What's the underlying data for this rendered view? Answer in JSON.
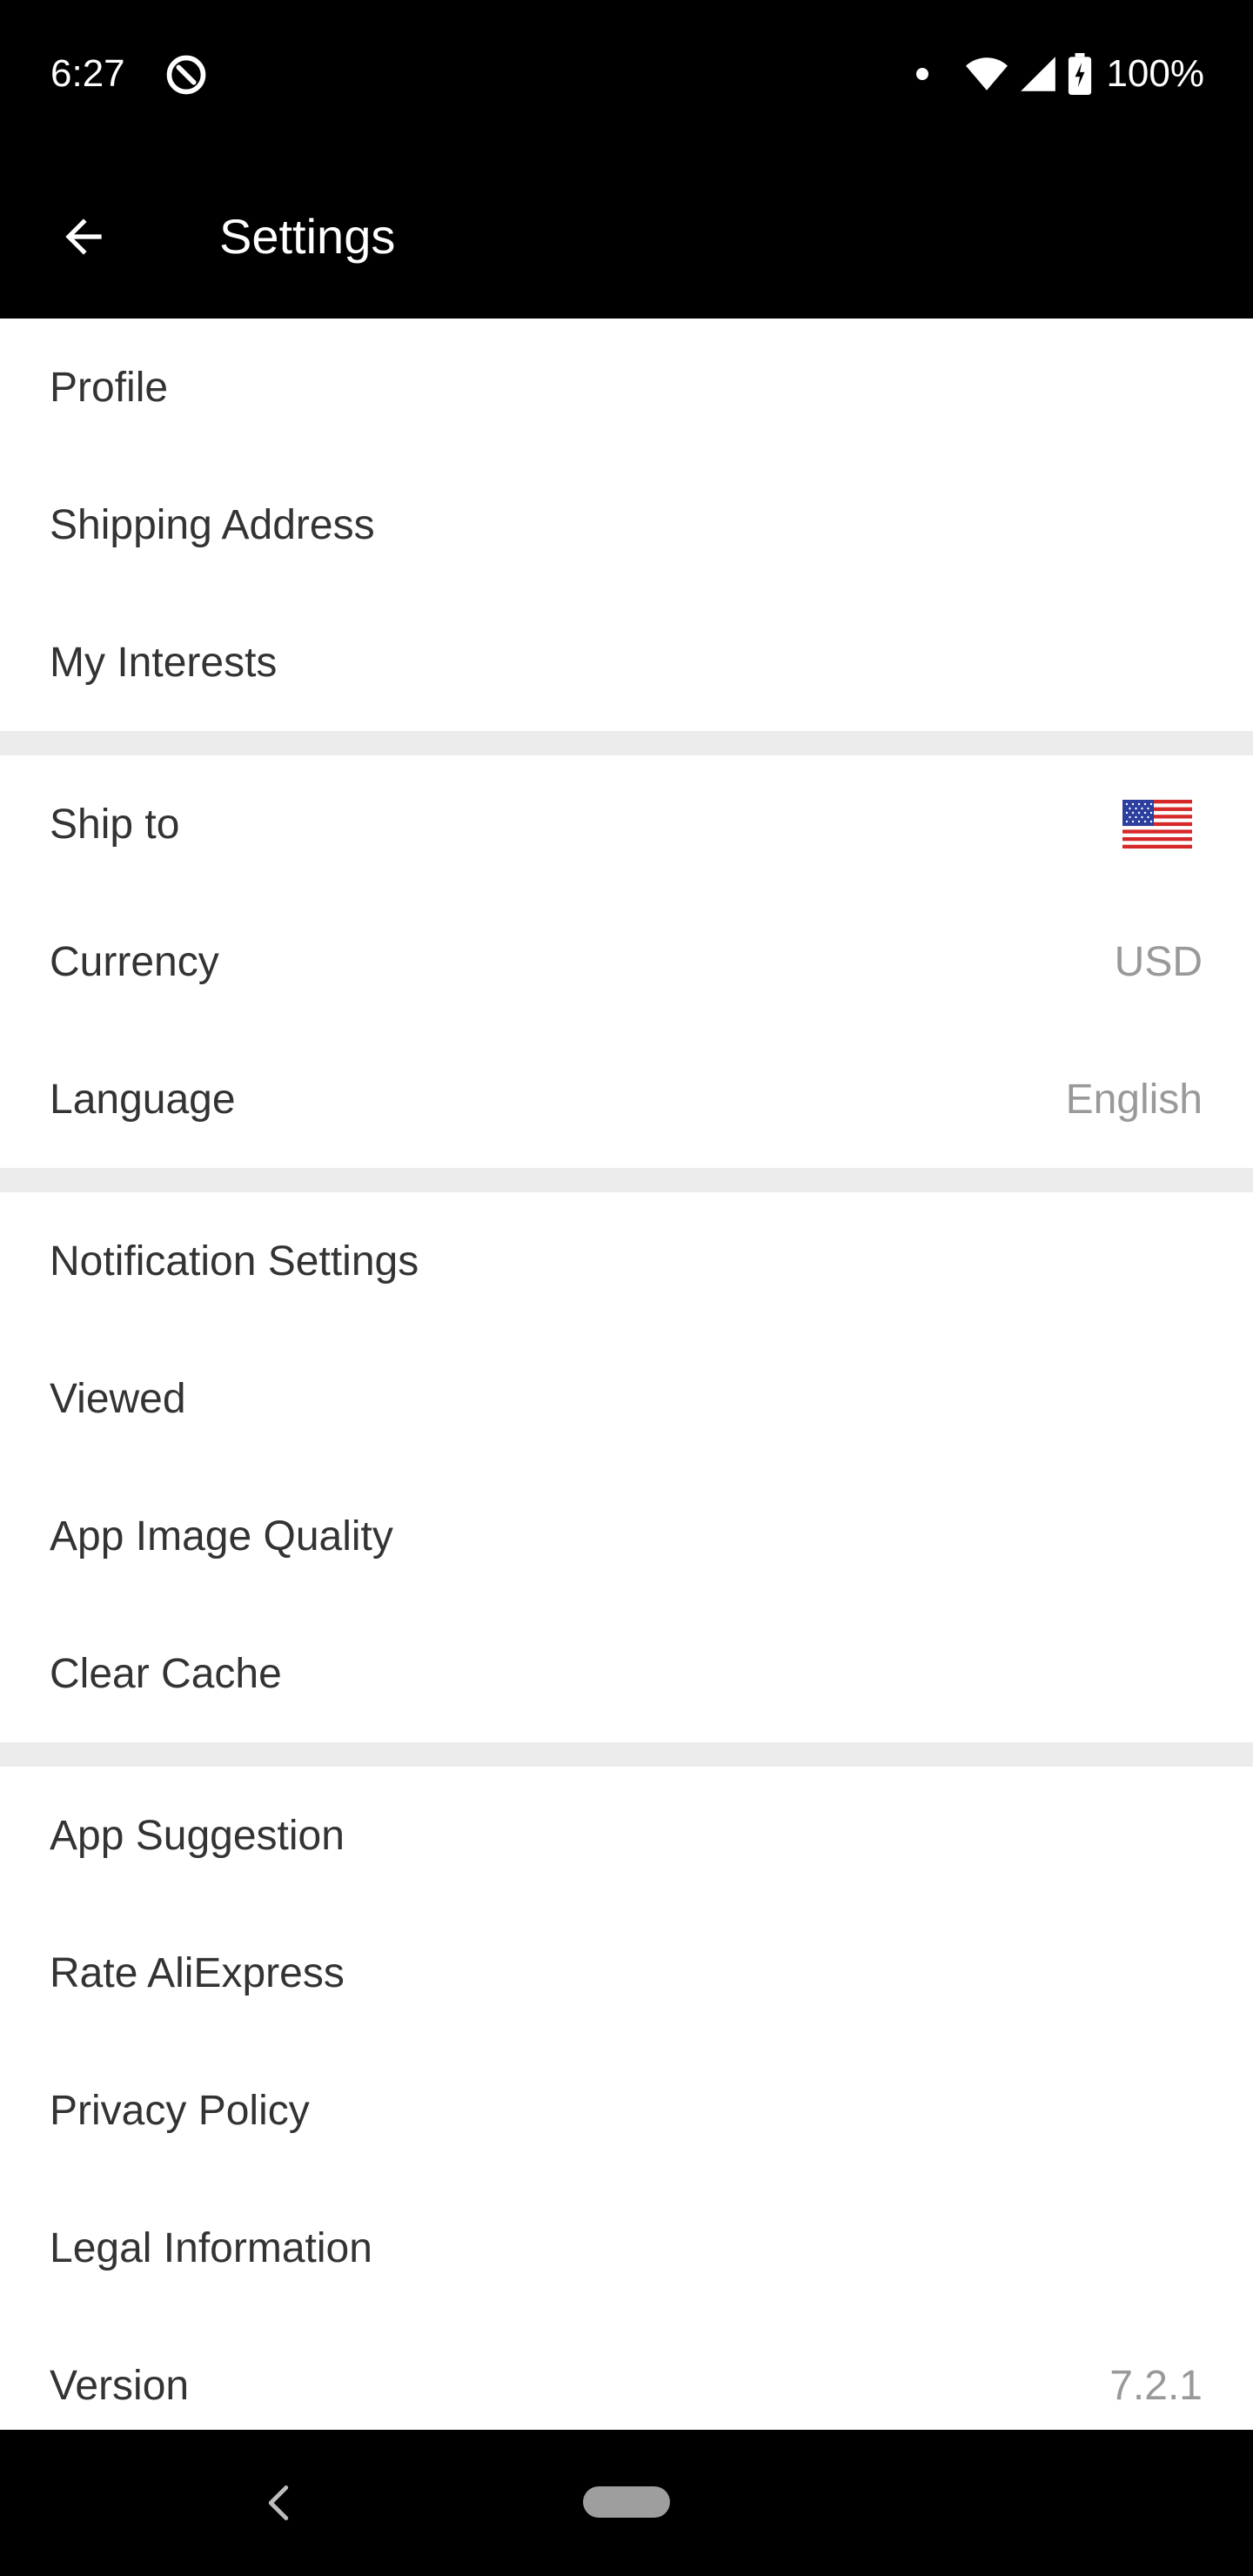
{
  "status_bar": {
    "time": "6:27",
    "battery": "100%",
    "icons": [
      "data-saver-icon",
      "notification-dot-icon",
      "wifi-icon",
      "signal-icon",
      "battery-charging-icon"
    ]
  },
  "app_bar": {
    "title": "Settings",
    "back_icon": "arrow-back-icon"
  },
  "groups": [
    {
      "items": [
        {
          "label": "Profile"
        },
        {
          "label": "Shipping Address"
        },
        {
          "label": "My Interests"
        }
      ]
    },
    {
      "items": [
        {
          "label": "Ship to",
          "value_icon": "us-flag-icon"
        },
        {
          "label": "Currency",
          "value": "USD"
        },
        {
          "label": "Language",
          "value": "English"
        }
      ]
    },
    {
      "items": [
        {
          "label": "Notification Settings"
        },
        {
          "label": "Viewed"
        },
        {
          "label": "App Image Quality"
        },
        {
          "label": "Clear Cache"
        }
      ]
    },
    {
      "items": [
        {
          "label": "App Suggestion"
        },
        {
          "label": "Rate AliExpress"
        },
        {
          "label": "Privacy Policy"
        },
        {
          "label": "Legal Information"
        },
        {
          "label": "Version",
          "value": "7.2.1"
        }
      ]
    }
  ],
  "nav_bar": {
    "back_icon": "nav-back-icon",
    "home_icon": "nav-home-pill-icon"
  },
  "colors": {
    "bar_background": "#000000",
    "divider": "#ececec",
    "label_text": "#333333",
    "value_text": "#999999"
  }
}
